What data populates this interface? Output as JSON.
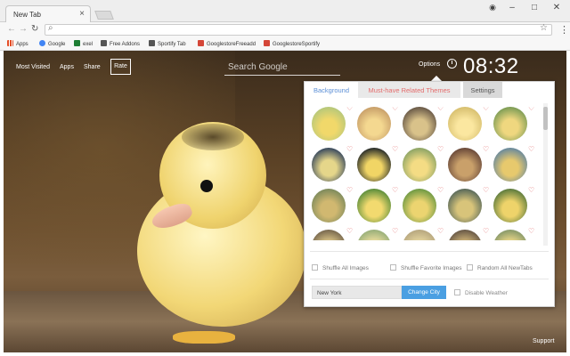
{
  "browser": {
    "tab_title": "New Tab",
    "tab_close": "×",
    "window_controls": {
      "minimize": "–",
      "maximize": "□",
      "close": "✕"
    },
    "nav": {
      "back": "←",
      "forward": "→",
      "reload": "↻"
    },
    "omnibox": {
      "icon": "search-icon",
      "value": ""
    },
    "star": "☆",
    "menu": "⋮",
    "bookmarks": [
      {
        "label": "Apps",
        "color": "#e44d26"
      },
      {
        "label": "Google",
        "color": "#4285f4"
      },
      {
        "label": "exel",
        "color": "#1e7e34"
      },
      {
        "label": "Free Addons",
        "color": "#333333"
      },
      {
        "label": "Sportify Tab",
        "color": "#333333"
      },
      {
        "label": "GooglestoreFreeadd",
        "color": "#d44638"
      },
      {
        "label": "GooglestoreSportify",
        "color": "#d44638"
      }
    ]
  },
  "page": {
    "nav": {
      "most_visited": "Most Visited",
      "apps": "Apps",
      "share": "Share",
      "rate": "Rate"
    },
    "search_placeholder": "Search Google",
    "options": "Options",
    "clock": "08:32",
    "support": "Support"
  },
  "panel": {
    "tabs": {
      "background": "Background",
      "must_have": "Must-have Related Themes",
      "settings": "Settings"
    },
    "heart": "♡",
    "thumbnails": [
      {
        "colors": [
          "#b7c87a",
          "#f1d86a"
        ]
      },
      {
        "colors": [
          "#c9a06a",
          "#f4d890"
        ]
      },
      {
        "colors": [
          "#6a5a48",
          "#d9c28a"
        ]
      },
      {
        "colors": [
          "#d8c070",
          "#fbe7a0"
        ]
      },
      {
        "colors": [
          "#7e9d56",
          "#efd77f"
        ]
      },
      {
        "colors": [
          "#3b4b5e",
          "#e5d68a"
        ]
      },
      {
        "colors": [
          "#2a2e2a",
          "#f1d565"
        ]
      },
      {
        "colors": [
          "#8ea566",
          "#f4dc84"
        ]
      },
      {
        "colors": [
          "#6b4a3a",
          "#c9a06a"
        ]
      },
      {
        "colors": [
          "#6a8a9c",
          "#e7c96d"
        ]
      },
      {
        "colors": [
          "#7e8b5c",
          "#d1b870"
        ]
      },
      {
        "colors": [
          "#5e8f3c",
          "#f2da6f"
        ]
      },
      {
        "colors": [
          "#6f9a44",
          "#ecd470"
        ]
      },
      {
        "colors": [
          "#5a6a5a",
          "#d8c47a"
        ]
      },
      {
        "colors": [
          "#5e7c3e",
          "#eed36a"
        ]
      },
      {
        "colors": [
          "#7a6a50",
          "#e0c98a"
        ]
      },
      {
        "colors": [
          "#9ab07a",
          "#f0e0a0"
        ]
      },
      {
        "colors": [
          "#b8a880",
          "#e8d8a0"
        ]
      },
      {
        "colors": [
          "#6a5a48",
          "#d4b87a"
        ]
      },
      {
        "colors": [
          "#8a9a6a",
          "#f2dc8a"
        ]
      }
    ],
    "checkboxes": {
      "shuffle_all": "Shuffle All Images",
      "shuffle_fav": "Shuffle Favorite Images",
      "random_newtabs": "Random All NewTabs"
    },
    "city": {
      "value": "New York",
      "button": "Change City",
      "disable_weather": "Disable Weather"
    }
  }
}
